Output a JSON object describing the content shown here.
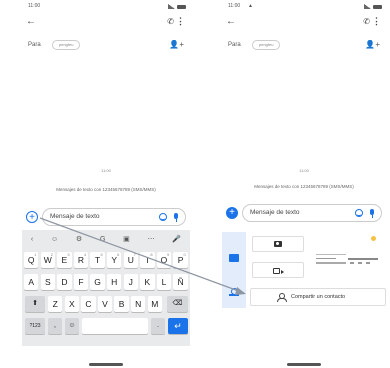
{
  "left": {
    "status_time": "11:00",
    "to_label": "Para",
    "recipient_chip": "pengfeu",
    "date_label": "11:00",
    "sms_note": "Mensajes de texto con 12345678789 (SMS/MMS)",
    "message_placeholder": "Mensaje de texto",
    "keyboard": {
      "toolbar": [
        "‹",
        "☺",
        "⚙",
        "G",
        "▣",
        "⋯",
        "🎤"
      ],
      "row1": [
        {
          "k": "Q",
          "h": "1"
        },
        {
          "k": "W",
          "h": "2"
        },
        {
          "k": "E",
          "h": "3"
        },
        {
          "k": "R",
          "h": "4"
        },
        {
          "k": "T",
          "h": "5"
        },
        {
          "k": "Y",
          "h": "6"
        },
        {
          "k": "U",
          "h": "7"
        },
        {
          "k": "I",
          "h": "8"
        },
        {
          "k": "O",
          "h": "9"
        },
        {
          "k": "P",
          "h": "0"
        }
      ],
      "row2": [
        "A",
        "S",
        "D",
        "F",
        "G",
        "H",
        "J",
        "K",
        "L",
        "Ñ"
      ],
      "row3": [
        "Z",
        "X",
        "C",
        "V",
        "B",
        "N",
        "M"
      ],
      "shift": "⬆",
      "backspace": "⌫",
      "symbols": "?123",
      "comma": ",",
      "emoji": "☺",
      "period": ".",
      "enter": "↵"
    }
  },
  "right": {
    "status_time": "11:00",
    "to_label": "Para",
    "recipient_chip": "pengfeu",
    "date_label": "11:00",
    "sms_note": "Mensajes de texto con 12345678789 (SMS/MMS)",
    "message_placeholder": "Mensaje de texto",
    "share_contact": "Compartir un contacto"
  },
  "colors": {
    "accent": "#1a73e8",
    "keyboard_bg": "#e9eaec",
    "arrow": "#8e96a3"
  }
}
